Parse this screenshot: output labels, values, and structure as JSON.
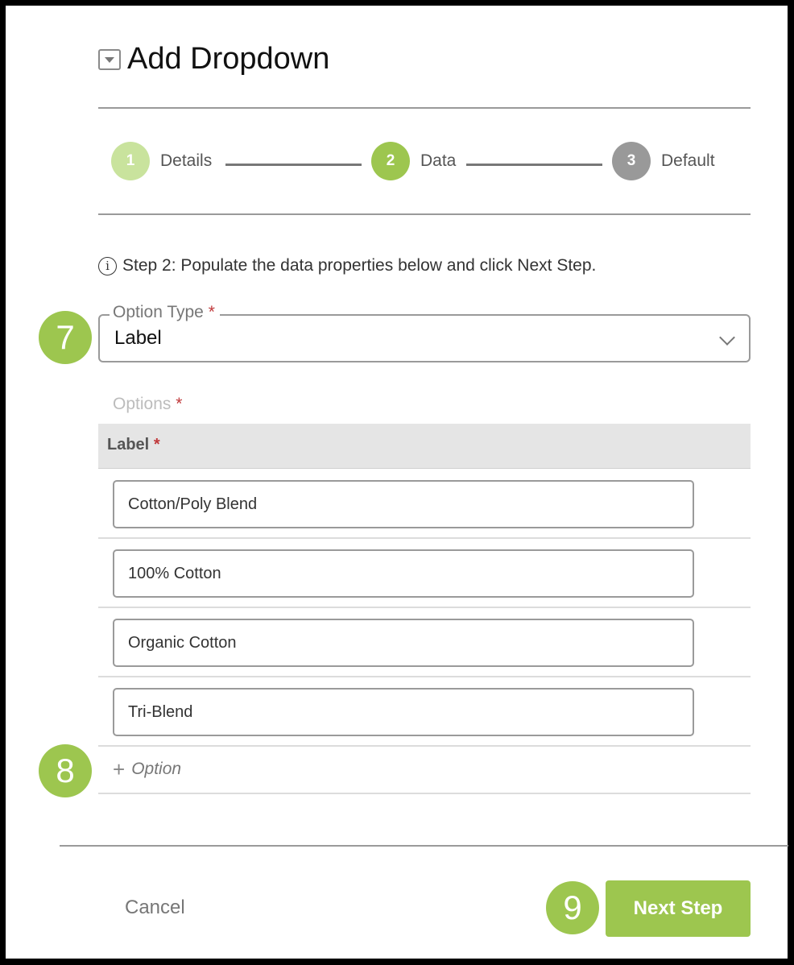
{
  "dialog": {
    "title": "Add Dropdown",
    "icon": "dropdown-icon"
  },
  "stepper": {
    "steps": [
      {
        "number": "1",
        "label": "Details",
        "state": "completed",
        "color": "#c9e39d"
      },
      {
        "number": "2",
        "label": "Data",
        "state": "active",
        "color": "#9dc64f"
      },
      {
        "number": "3",
        "label": "Default",
        "state": "pending",
        "color": "#999999"
      }
    ]
  },
  "info": {
    "icon": "info-icon",
    "text": "Step 2: Populate the data properties below and click Next Step."
  },
  "callouts": {
    "option_type": "7",
    "add_option": "8",
    "next_step": "9",
    "color": "#9dc64f"
  },
  "option_type": {
    "label": "Option Type",
    "required_mark": "*",
    "value": "Label"
  },
  "options": {
    "label": "Options",
    "required_mark": "*",
    "column_header": "Label",
    "column_required_mark": "*",
    "rows": [
      "Cotton/Poly Blend",
      "100% Cotton",
      "Organic Cotton",
      "Tri-Blend"
    ],
    "add_label": "Option"
  },
  "footer": {
    "cancel_label": "Cancel",
    "next_label": "Next Step"
  },
  "colors": {
    "accent": "#9dc64f",
    "required": "#c0393b"
  }
}
